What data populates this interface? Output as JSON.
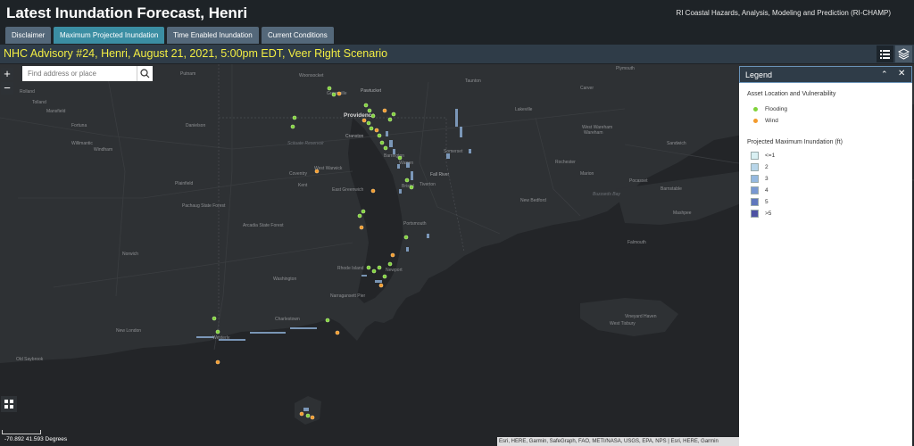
{
  "header": {
    "title": "Latest Inundation Forecast, Henri",
    "organization": "RI Coastal Hazards, Analysis, Modeling and Prediction (RI-CHAMP)"
  },
  "tabs": [
    {
      "label": "Disclaimer",
      "active": false
    },
    {
      "label": "Maximum Projected Inundation",
      "active": true
    },
    {
      "label": "Time Enabled Inundation",
      "active": false
    },
    {
      "label": "Current Conditions",
      "active": false
    }
  ],
  "advisory": {
    "text": "NHC Advisory #24, Henri, August 21, 2021, 5:00pm EDT, Veer Right Scenario"
  },
  "search": {
    "placeholder": "Find address or place"
  },
  "map": {
    "zoom_in": "+",
    "zoom_out": "−",
    "coordinates": "-70.892 41.593 Degrees",
    "attribution": "Esri, HERE, Garmin, SafeGraph, FAO, METI/NASA, USGS, EPA, NPS | Esri, HERE, Garmin",
    "place_labels": [
      "Putnam",
      "Woonsocket",
      "Pawtucket",
      "Greenville",
      "Taunton",
      "Carver",
      "Wareham",
      "Plymouth",
      "Rolland",
      "Tolland",
      "Providence",
      "Cranston",
      "Danielson",
      "Scituate Reservoir",
      "Coventry",
      "West Warwick",
      "Barrington",
      "Warren",
      "Somerset",
      "Fall River",
      "Lakeville",
      "West Wareham",
      "Sandwich",
      "Willimantic",
      "Windham",
      "Plainfield",
      "East Greenwich",
      "Bristol",
      "Tiverton",
      "New Bedford",
      "Rochester",
      "Marion",
      "Pocasset",
      "Falmouth",
      "Mashpee",
      "Barnstable",
      "Buzzards Bay",
      "Portsmouth",
      "Newport",
      "Norwich",
      "Narragansett Pier",
      "Charlestown",
      "Westerly",
      "New London",
      "Old Saybrook",
      "Arcadia State Forest",
      "Pachaug State Forest",
      "Mansfield",
      "Fortuna",
      "Rhode Island",
      "Washington",
      "Kent",
      "West Tisbury",
      "Vineyard Haven"
    ]
  },
  "legend": {
    "title": "Legend",
    "collapse_icon": "chevron-up-icon",
    "close_icon": "close-icon",
    "asset_heading": "Asset Location and Vulnerability",
    "assets": [
      {
        "label": "Flooding",
        "color": "#7fd23a"
      },
      {
        "label": "Wind",
        "color": "#f39a2b"
      }
    ],
    "inundation_heading": "Projected Maximum Inundation (ft)",
    "inundation": [
      {
        "label": "<=1",
        "color": "#d9f0f3"
      },
      {
        "label": "2",
        "color": "#b8d6ea"
      },
      {
        "label": "3",
        "color": "#95b9e0"
      },
      {
        "label": "4",
        "color": "#7898d2"
      },
      {
        "label": "5",
        "color": "#5f77bd"
      },
      {
        "label": ">5",
        "color": "#4d52a3"
      }
    ]
  },
  "icons": {
    "search": "search-icon",
    "legend_list": "list-icon",
    "layers": "layers-icon",
    "basemap": "grid-icon"
  }
}
